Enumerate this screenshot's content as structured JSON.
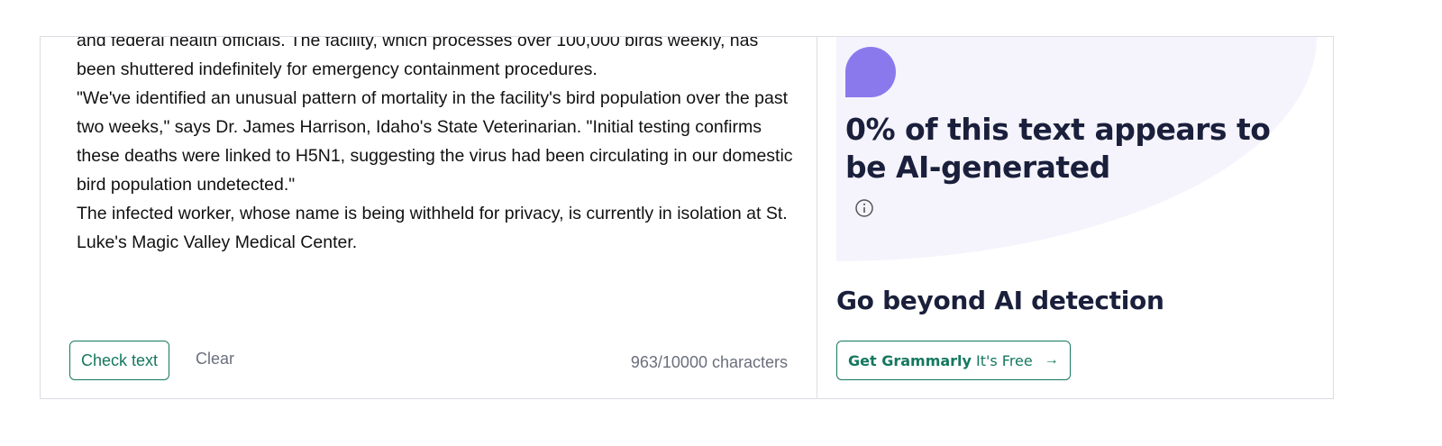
{
  "editor": {
    "paragraphs": [
      "and federal health officials. The facility, which processes over 100,000 birds weekly, has been shuttered indefinitely for emergency containment procedures.",
      "\"We've identified an unusual pattern of mortality in the facility's bird population over the past two weeks,\" says Dr. James Harrison, Idaho's State Veterinarian. \"Initial testing confirms these deaths were linked to H5N1, suggesting the virus had been circulating in our domestic bird population undetected.\"",
      "The infected worker, whose name is being withheld for privacy, is currently in isolation at St. Luke's Magic Valley Medical Center."
    ],
    "check_label": "Check text",
    "clear_label": "Clear",
    "char_count": "963/10000 characters"
  },
  "result": {
    "title": "0% of this text appears to be AI-generated",
    "info_icon": "info-icon",
    "accent_color": "#8a79ec",
    "bg_color": "#f5f4fd"
  },
  "promo": {
    "heading": "Go beyond AI detection",
    "cta_strong": "Get Grammarly",
    "cta_free": "It's Free",
    "cta_arrow": "→",
    "brand_color": "#15785f"
  }
}
